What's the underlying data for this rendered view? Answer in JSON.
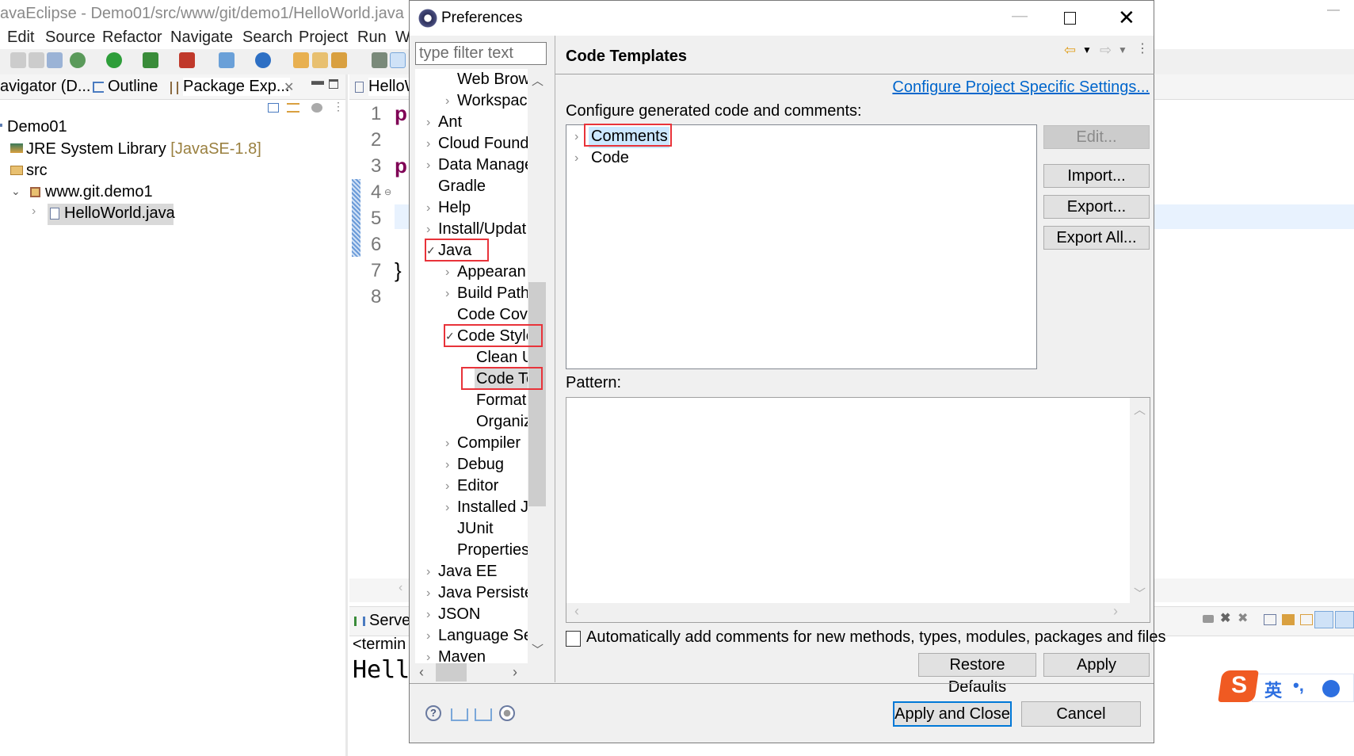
{
  "eclipse": {
    "window_title": "avaEclipse - Demo01/src/www/git/demo1/HelloWorld.java -",
    "menu": [
      "Edit",
      "Source",
      "Refactor",
      "Navigate",
      "Search",
      "Project",
      "Run",
      "W"
    ],
    "view_tabs": {
      "navigator": "avigator (D...",
      "outline": "Outline",
      "package_explorer": "Package Exp..."
    },
    "tree": {
      "project": "Demo01",
      "jre": "JRE System Library",
      "jre_version": "[JavaSE-1.8]",
      "src": "src",
      "package": "www.git.demo1",
      "file": "HelloWorld.java"
    },
    "editor": {
      "tab": "HelloW",
      "line_numbers": [
        "1",
        "2",
        "3",
        "4",
        "5",
        "6",
        "7",
        "8"
      ],
      "code_fragments": {
        "line1": "p",
        "line3": "p",
        "line7": "}"
      }
    },
    "bottom": {
      "servers_tab": "Server",
      "console_header": "<termin",
      "console_output": "Hello"
    },
    "ime": {
      "lang": "英",
      "punct": "•,"
    }
  },
  "dialog": {
    "title": "Preferences",
    "filter_placeholder": "type filter text",
    "page_title": "Code Templates",
    "project_settings_link": "Configure Project Specific Settings...",
    "configure_label": "Configure generated code and comments:",
    "templates": [
      {
        "label": "Comments",
        "selected": true
      },
      {
        "label": "Code",
        "selected": false
      }
    ],
    "buttons": {
      "edit": "Edit...",
      "import": "Import...",
      "export": "Export...",
      "export_all": "Export All...",
      "restore_defaults": "Restore Defaults",
      "apply": "Apply",
      "apply_and_close": "Apply and Close",
      "cancel": "Cancel"
    },
    "pattern_label": "Pattern:",
    "auto_comments_label": "Automatically add comments for new methods, types, modules, packages and files",
    "auto_comments_checked": false,
    "nav_tree": [
      {
        "level": 2,
        "chevron": "none",
        "label": "Web Brow"
      },
      {
        "level": 2,
        "chevron": "collapsed",
        "label": "Workspac"
      },
      {
        "level": 1,
        "chevron": "collapsed",
        "label": "Ant"
      },
      {
        "level": 1,
        "chevron": "collapsed",
        "label": "Cloud Found"
      },
      {
        "level": 1,
        "chevron": "collapsed",
        "label": "Data Manage"
      },
      {
        "level": 1,
        "chevron": "none",
        "label": "Gradle"
      },
      {
        "level": 1,
        "chevron": "collapsed",
        "label": "Help"
      },
      {
        "level": 1,
        "chevron": "collapsed",
        "label": "Install/Updat"
      },
      {
        "level": 1,
        "chevron": "expanded",
        "label": "Java",
        "highlight": true
      },
      {
        "level": 2,
        "chevron": "collapsed",
        "label": "Appearan"
      },
      {
        "level": 2,
        "chevron": "collapsed",
        "label": "Build Path"
      },
      {
        "level": 2,
        "chevron": "none",
        "label": "Code Cove"
      },
      {
        "level": 2,
        "chevron": "expanded",
        "label": "Code Style",
        "highlight": true
      },
      {
        "level": 3,
        "chevron": "none",
        "label": "Clean U"
      },
      {
        "level": 3,
        "chevron": "none",
        "label": "Code Te",
        "selected": true,
        "highlight": true
      },
      {
        "level": 3,
        "chevron": "none",
        "label": "Format"
      },
      {
        "level": 3,
        "chevron": "none",
        "label": "Organiz"
      },
      {
        "level": 2,
        "chevron": "collapsed",
        "label": "Compiler"
      },
      {
        "level": 2,
        "chevron": "collapsed",
        "label": "Debug"
      },
      {
        "level": 2,
        "chevron": "collapsed",
        "label": "Editor"
      },
      {
        "level": 2,
        "chevron": "collapsed",
        "label": "Installed J"
      },
      {
        "level": 2,
        "chevron": "none",
        "label": "JUnit"
      },
      {
        "level": 2,
        "chevron": "none",
        "label": "Properties"
      },
      {
        "level": 1,
        "chevron": "collapsed",
        "label": "Java EE"
      },
      {
        "level": 1,
        "chevron": "collapsed",
        "label": "Java Persister"
      },
      {
        "level": 1,
        "chevron": "collapsed",
        "label": "JSON"
      },
      {
        "level": 1,
        "chevron": "collapsed",
        "label": "Language Se"
      },
      {
        "level": 1,
        "chevron": "collapsed",
        "label": "Maven"
      }
    ]
  },
  "colors": {
    "link": "#0066cc",
    "highlight_box": "#e8333a",
    "selection": "#cce8ff",
    "focus": "#0078d7",
    "keyword": "#7f0055"
  }
}
